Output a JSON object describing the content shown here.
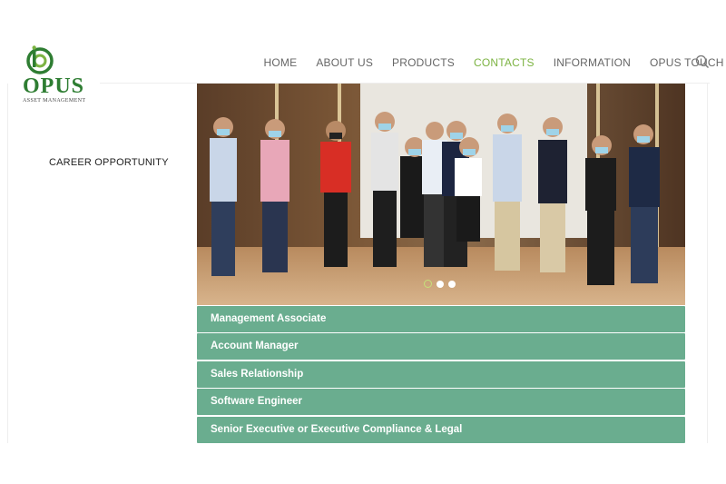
{
  "brand": {
    "name": "OPUS",
    "tagline": "ASSET MANAGEMENT",
    "color": "#2e7d32"
  },
  "nav": {
    "items": [
      "HOME",
      "ABOUT US",
      "PRODUCTS",
      "CONTACTS",
      "INFORMATION",
      "OPUS TOUCH"
    ],
    "active_index": 3,
    "active_color": "#7cb342",
    "search_icon": "search-icon"
  },
  "sidebar": {
    "title": "CAREER OPPORTUNITY"
  },
  "carousel": {
    "slide_count": 3,
    "active_slide": 1
  },
  "jobs": {
    "items": [
      "Management Associate",
      "Account Manager",
      "Sales Relationship",
      "Software Engineer",
      "Senior Executive or Executive Compliance & Legal"
    ],
    "color": "#6aad8f"
  }
}
